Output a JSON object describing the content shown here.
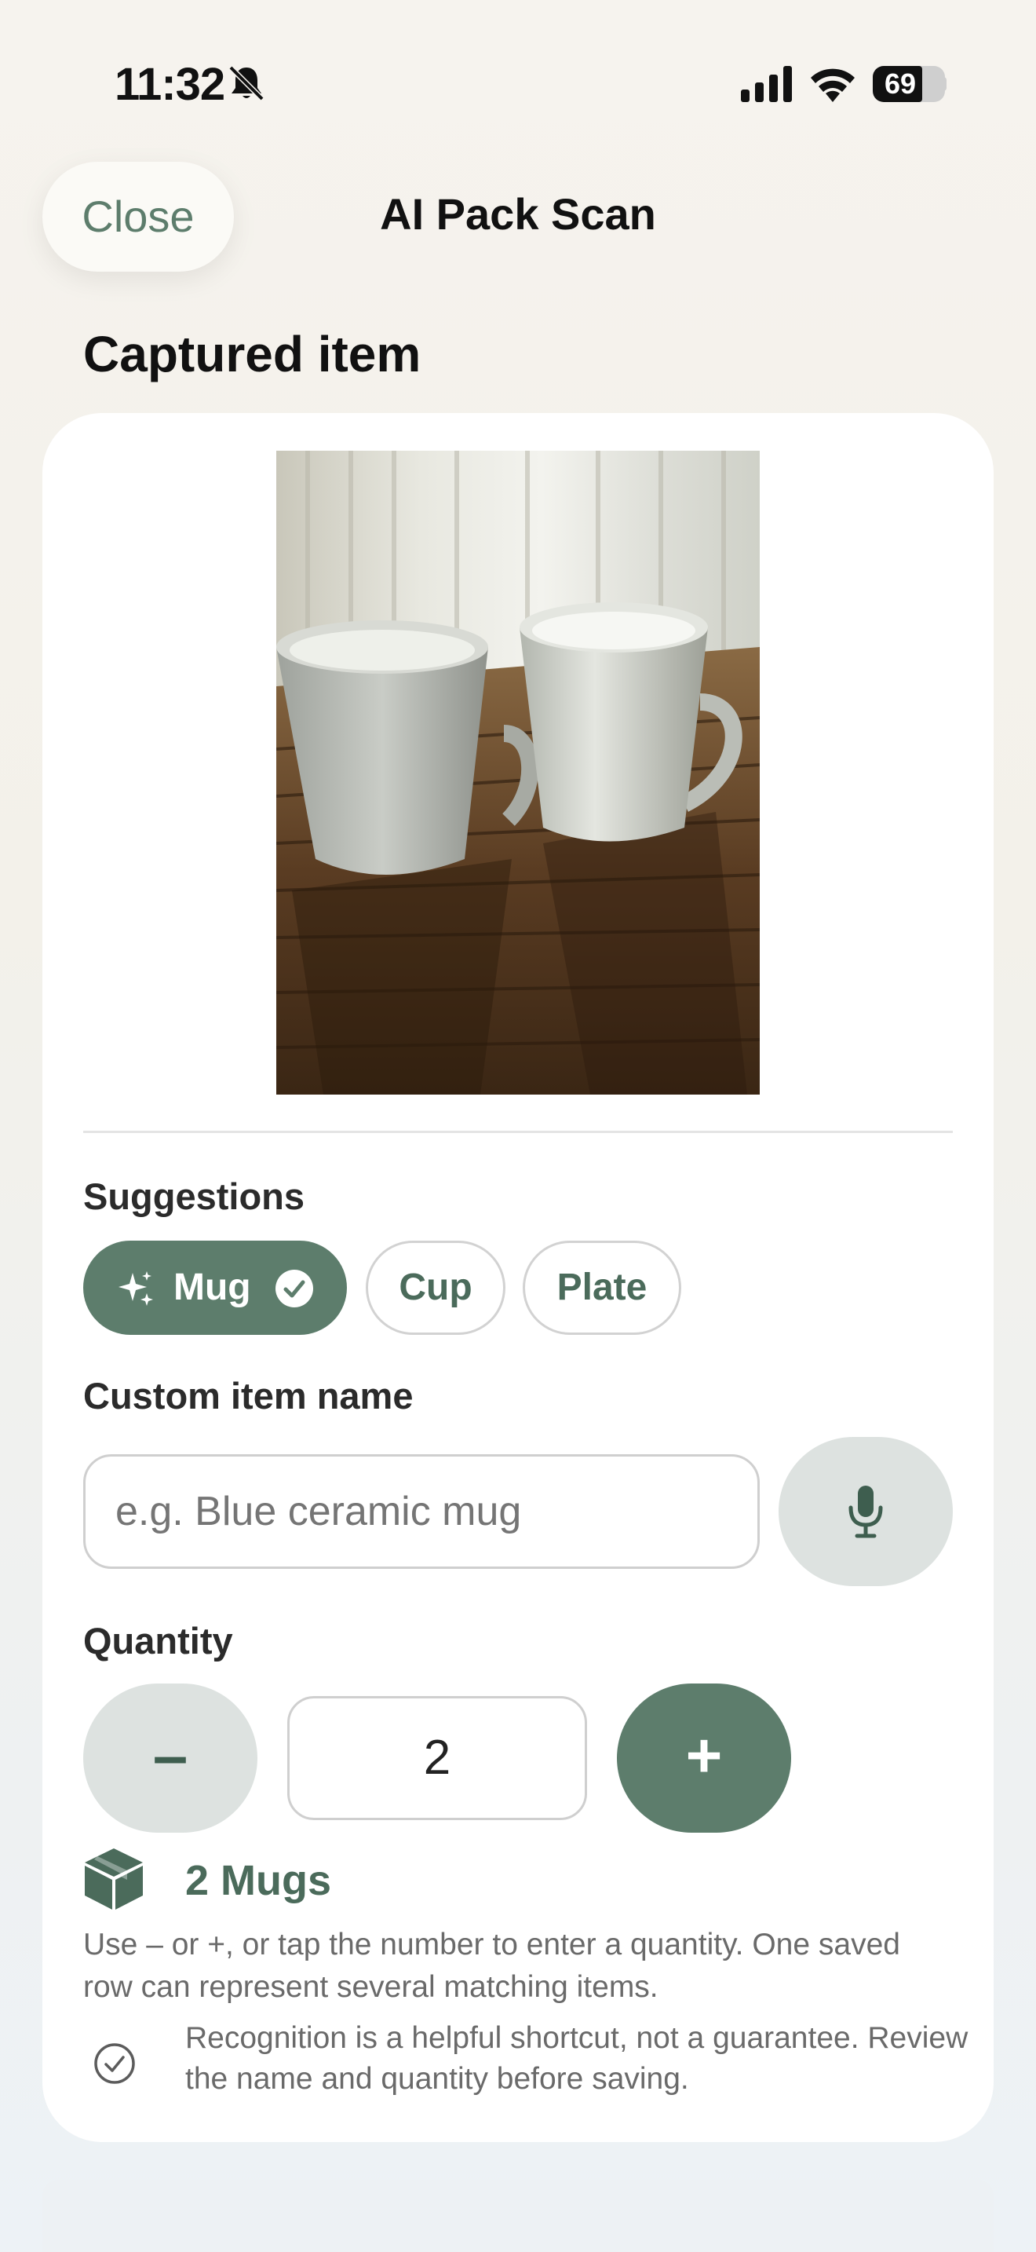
{
  "status_bar": {
    "time": "11:32",
    "battery_percent": "69",
    "battery_level": 0.69,
    "icons": [
      "bell-slash-icon",
      "cellular-signal-icon",
      "wifi-icon",
      "battery-icon"
    ]
  },
  "header": {
    "close_label": "Close",
    "title": "AI Pack Scan"
  },
  "captured": {
    "section_title": "Captured item",
    "photo_description_icon": "captured-photo"
  },
  "suggestions": {
    "label": "Suggestions",
    "items": [
      {
        "label": "Mug",
        "selected": true,
        "icons": [
          "sparkles-icon",
          "checkmark-circle-icon"
        ]
      },
      {
        "label": "Cup",
        "selected": false
      },
      {
        "label": "Plate",
        "selected": false
      }
    ]
  },
  "custom_name": {
    "label": "Custom item name",
    "placeholder": "e.g. Blue ceramic mug",
    "value": "",
    "mic_icon": "microphone-icon"
  },
  "quantity": {
    "label": "Quantity",
    "minus_label": "–",
    "plus_label": "+",
    "value": "2"
  },
  "summary": {
    "icon": "box-icon",
    "text": "2 Mugs",
    "hint": "Use – or +, or tap the number to enter a quantity. One saved row can represent several matching items."
  },
  "disclaimer": {
    "icon": "checkmark-circle-icon",
    "text": "Recognition is a helpful shortcut, not a guarantee. Review the name and quantity before saving."
  },
  "colors": {
    "accent": "#5d7d6c",
    "accent_text": "#4b6b5b",
    "soft_button": "#dde2e0",
    "card": "#ffffff"
  }
}
